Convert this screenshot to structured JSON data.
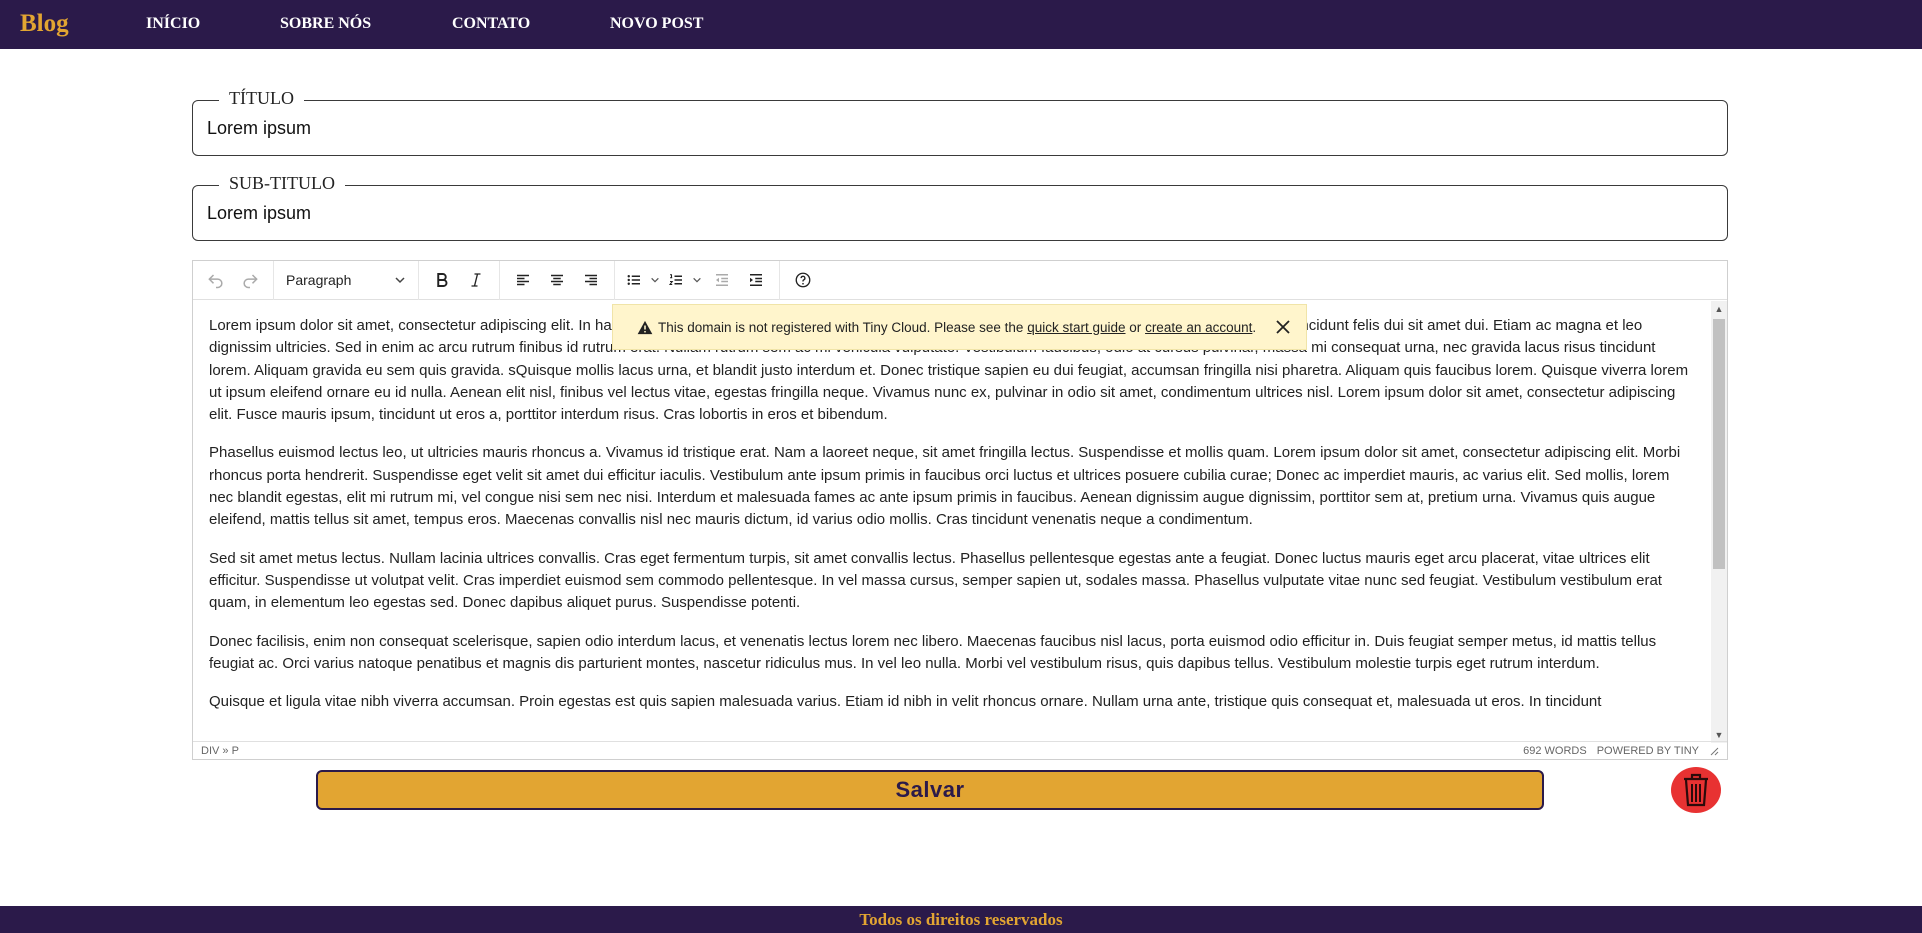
{
  "nav": {
    "brand": "Blog",
    "links": [
      {
        "label": "INÍCIO"
      },
      {
        "label": "SOBRE NÓS"
      },
      {
        "label": "CONTATO"
      },
      {
        "label": "NOVO POST"
      }
    ]
  },
  "form": {
    "title_label": "TÍTULO",
    "title_value": "Lorem ipsum",
    "subtitle_label": "SUB-TITULO",
    "subtitle_value": "Lorem ipsum"
  },
  "editor": {
    "block_format": "Paragraph",
    "paragraphs": [
      "Lorem ipsum dolor sit amet, consectetur adipiscing elit. In hac habitasse platea dictumst. Fusce sodales, sapien nec varius vestibulum, dui lorem pretium ante, sed tincidunt felis dui sit amet dui. Etiam ac magna et leo dignissim ultricies. Sed in enim ac arcu rutrum finibus id rutrum erat. Nullam rutrum sem ac mi vehicula vulputate. Vestibulum faucibus, odio at cursus pulvinar, massa mi consequat urna, nec gravida lacus risus tincidunt lorem. Aliquam gravida eu sem quis gravida. sQuisque mollis lacus urna, et blandit justo interdum et. Donec tristique sapien eu dui feugiat, accumsan fringilla nisi pharetra. Aliquam quis faucibus lorem. Quisque viverra lorem ut ipsum eleifend ornare eu id nulla. Aenean elit nisl, finibus vel lectus vitae, egestas fringilla neque. Vivamus nunc ex, pulvinar in odio sit amet, condimentum ultrices nisl. Lorem ipsum dolor sit amet, consectetur adipiscing elit. Fusce mauris ipsum, tincidunt ut eros a, porttitor interdum risus. Cras lobortis in eros et bibendum.",
      "Phasellus euismod lectus leo, ut ultricies mauris rhoncus a. Vivamus id tristique erat. Nam a laoreet neque, sit amet fringilla lectus. Suspendisse et mollis quam. Lorem ipsum dolor sit amet, consectetur adipiscing elit. Morbi rhoncus porta hendrerit. Suspendisse eget velit sit amet dui efficitur iaculis. Vestibulum ante ipsum primis in faucibus orci luctus et ultrices posuere cubilia curae; Donec ac imperdiet mauris, ac varius elit. Sed mollis, lorem nec blandit egestas, elit mi rutrum mi, vel congue nisi sem nec nisi. Interdum et malesuada fames ac ante ipsum primis in faucibus. Aenean dignissim augue dignissim, porttitor sem at, pretium urna. Vivamus quis augue eleifend, mattis tellus sit amet, tempus eros. Maecenas convallis nisl nec mauris dictum, id varius odio mollis. Cras tincidunt venenatis neque a condimentum.",
      "Sed sit amet metus lectus. Nullam lacinia ultrices convallis. Cras eget fermentum turpis, sit amet convallis lectus. Phasellus pellentesque egestas ante a feugiat. Donec luctus mauris eget arcu placerat, vitae ultrices elit efficitur. Suspendisse ut volutpat velit. Cras imperdiet euismod sem commodo pellentesque. In vel massa cursus, semper sapien ut, sodales massa. Phasellus vulputate vitae nunc sed feugiat. Vestibulum vestibulum erat quam, in elementum leo egestas sed. Donec dapibus aliquet purus. Suspendisse potenti.",
      "Donec facilisis, enim non consequat scelerisque, sapien odio interdum lacus, et venenatis lectus lorem nec libero. Maecenas faucibus nisl lacus, porta euismod odio efficitur in. Duis feugiat semper metus, id mattis tellus feugiat ac. Orci varius natoque penatibus et magnis dis parturient montes, nascetur ridiculus mus. In vel leo nulla. Morbi vel vestibulum risus, quis dapibus tellus. Vestibulum molestie turpis eget rutrum interdum.",
      "Quisque et ligula vitae nibh viverra accumsan. Proin egestas est quis sapien malesuada varius. Etiam id nibh in velit rhoncus ornare. Nullam urna ante, tristique quis consequat et, malesuada ut eros. In tincidunt"
    ],
    "path": "DIV » P",
    "word_count": "692 WORDS",
    "powered_by": "POWERED BY TINY"
  },
  "notice": {
    "text_before": "This domain is not registered with Tiny Cloud. Please see the",
    "link1": "quick start guide",
    "text_middle": "or",
    "link2": "create an account",
    "text_after": "."
  },
  "actions": {
    "save_label": "Salvar"
  },
  "footer": {
    "text": "Todos os direitos reservados"
  },
  "colors": {
    "nav_bg": "#2b1a4a",
    "accent": "#e2a532",
    "delete": "#e83232",
    "notice_bg": "#fff5cc"
  },
  "icons": {
    "undo": "undo-icon",
    "redo": "redo-icon",
    "bold": "bold-icon",
    "italic": "italic-icon",
    "align_left": "align-left-icon",
    "align_center": "align-center-icon",
    "align_right": "align-right-icon",
    "bullet_list": "bullet-list-icon",
    "numbered_list": "numbered-list-icon",
    "outdent": "outdent-icon",
    "indent": "indent-icon",
    "help": "help-icon",
    "warning": "warning-icon",
    "close": "close-icon",
    "trash": "trash-icon"
  }
}
